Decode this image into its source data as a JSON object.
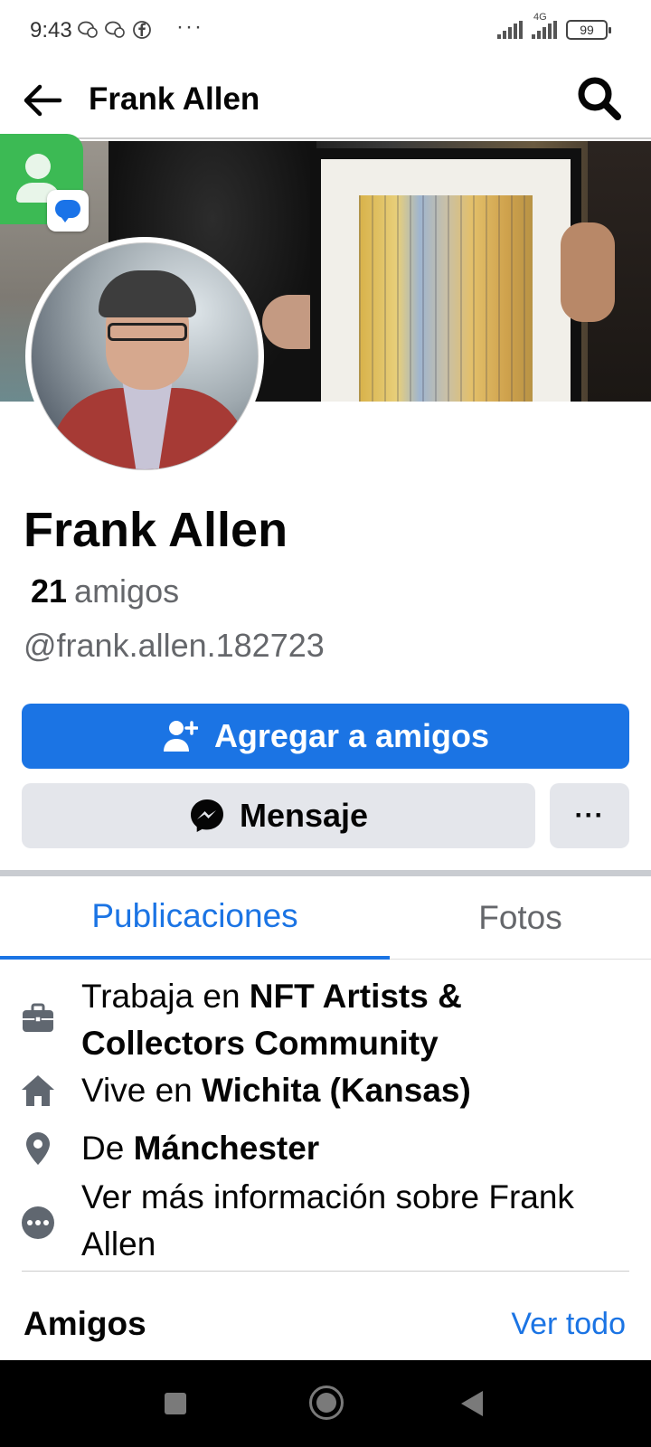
{
  "status_bar": {
    "time": "9:43",
    "more": "···",
    "network": "4G",
    "battery": "99"
  },
  "header": {
    "title": "Frank Allen"
  },
  "profile": {
    "name": "Frank Allen",
    "friends_count": "21",
    "friends_label": "amigos",
    "username": "@frank.allen.182723"
  },
  "actions": {
    "add_friend": "Agregar a amigos",
    "message": "Mensaje",
    "more": "···"
  },
  "tabs": [
    {
      "label": "Publicaciones",
      "active": true
    },
    {
      "label": "Fotos",
      "active": false
    }
  ],
  "details": {
    "work_prefix": "Trabaja en ",
    "work_value": "NFT Artists & Collectors Community",
    "lives_prefix": "Vive en ",
    "lives_value": "Wichita (Kansas)",
    "from_prefix": "De ",
    "from_value": "Mánchester",
    "see_more": "Ver más información sobre Frank Allen"
  },
  "friends_section": {
    "heading": "Amigos",
    "see_all": "Ver todo"
  },
  "colors": {
    "accent": "#1b74e4",
    "button_gray": "#e4e6eb",
    "secondary_text": "#65676b"
  }
}
